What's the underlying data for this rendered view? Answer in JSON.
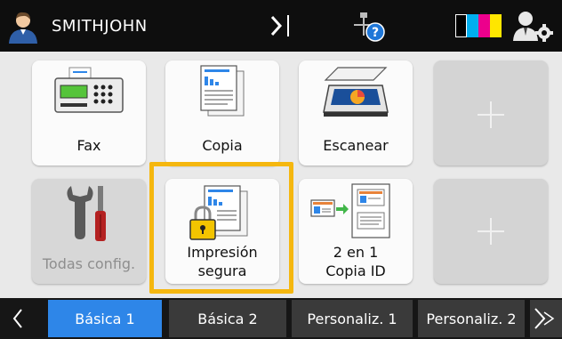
{
  "header": {
    "username": "SMITHJOHN"
  },
  "tiles": {
    "fax": "Fax",
    "copia": "Copia",
    "escanear": "Escanear",
    "todas_config": "Todas config.",
    "impresion_line1": "Impresión",
    "impresion_line2": "segura",
    "id_line1": "2 en 1",
    "id_line2": "Copia ID"
  },
  "tabs": [
    {
      "label": "Básica 1",
      "active": true
    },
    {
      "label": "Básica 2",
      "active": false
    },
    {
      "label": "Personaliz. 1",
      "active": false
    },
    {
      "label": "Personaliz. 2",
      "active": false
    }
  ],
  "colors": {
    "accent": "#2e86e8",
    "highlight": "#f5b70f",
    "ink_cyan": "#00aeef",
    "ink_magenta": "#ec008c",
    "ink_yellow": "#ffe600",
    "ink_black": "#000000"
  },
  "icons": [
    "user-icon",
    "expand-arrow-icon",
    "network-help-icon",
    "ink-levels-icon",
    "admin-settings-icon",
    "fax-icon",
    "copy-icon",
    "scanner-icon",
    "plus-icon",
    "tools-icon",
    "secure-print-icon",
    "id-copy-icon",
    "chevron-left-icon",
    "chevron-right-icon"
  ]
}
